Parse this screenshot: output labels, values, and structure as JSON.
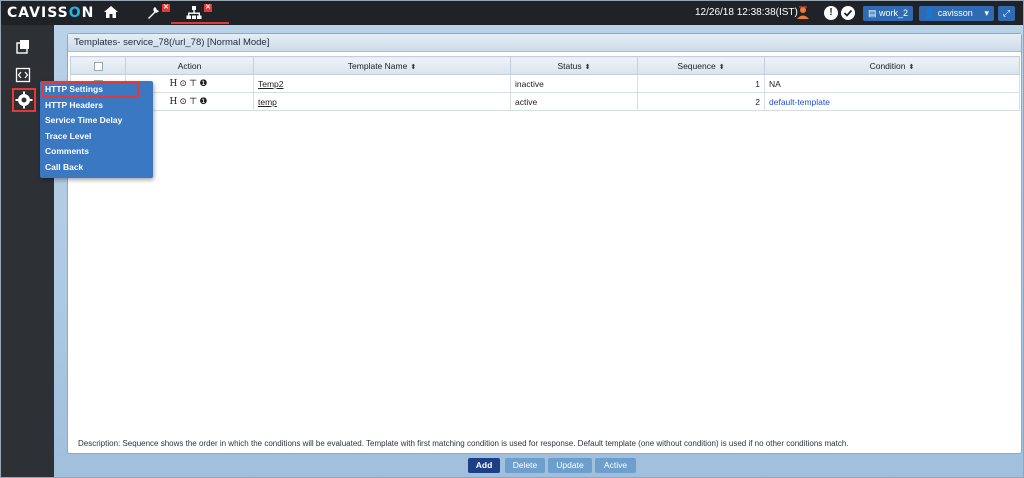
{
  "app": {
    "brand_before": "CAVISS",
    "brand_o": "O",
    "brand_after": "N"
  },
  "header": {
    "datetime": "12/26/18 12:38:38(IST)",
    "workspace_label": "work_2",
    "user_label": "cavisson",
    "alert_glyph": "!",
    "badge_glyph": "✕"
  },
  "panel": {
    "title": "Templates- service_78(/url_78) [Normal Mode]"
  },
  "table": {
    "columns": [
      "Action",
      "Template Name",
      "Status",
      "Sequence",
      "Condition"
    ],
    "rows": [
      {
        "actions": "H⊙⊤❶",
        "name": "Temp2",
        "status": "inactive",
        "sequence": "1",
        "condition": "NA"
      },
      {
        "actions": "H⊙⊤❶",
        "name": "temp",
        "status": "active",
        "sequence": "2",
        "condition": "default-template"
      }
    ]
  },
  "menu": {
    "items": [
      "HTTP Settings",
      "HTTP Headers",
      "Service Time Delay",
      "Trace Level",
      "Comments",
      "Call Back"
    ]
  },
  "footer": {
    "description": "Description: Sequence shows the order in which the conditions will be evaluated. Template with first matching condition is used for response. Default template (one without condition) is used if no other conditions match.",
    "buttons": {
      "add": "Add",
      "delete": "Delete",
      "update": "Update",
      "active": "Active"
    }
  },
  "colors": {
    "topbar": "#1f2328",
    "accent": "#2f6bb3",
    "menu": "#3b78c2",
    "highlight": "#e53935",
    "link": "#1f4fd8"
  }
}
